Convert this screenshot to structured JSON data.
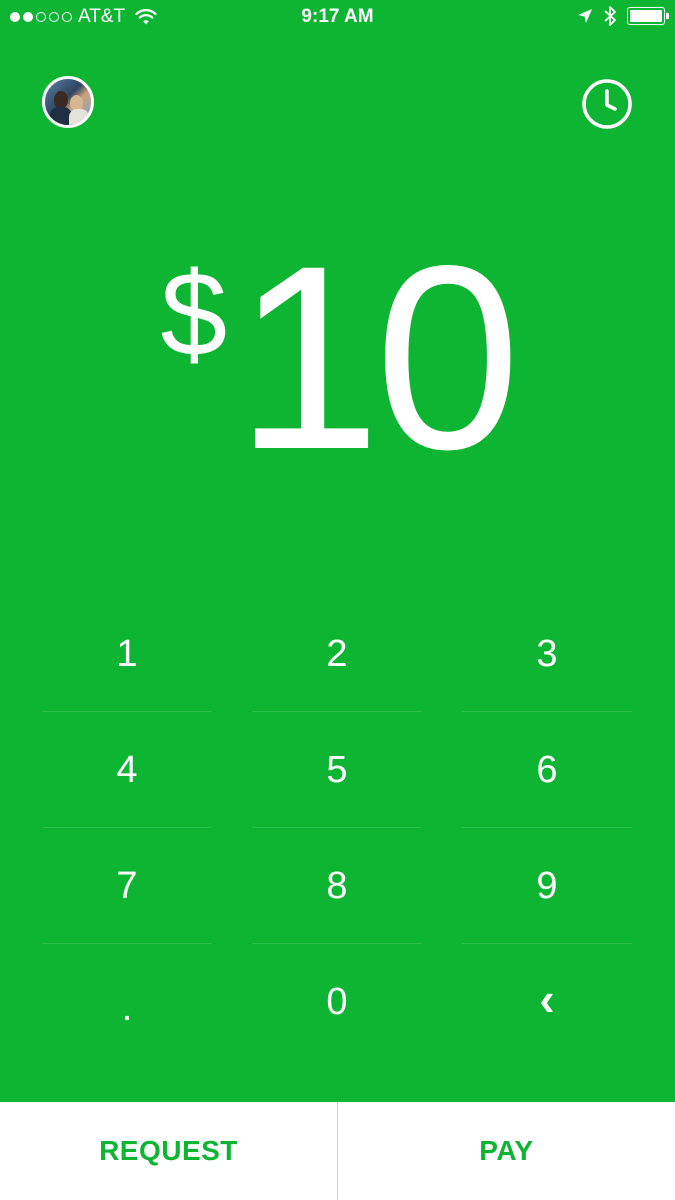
{
  "status_bar": {
    "carrier": "AT&T",
    "time": "9:17 AM",
    "signal_dots_filled": 2,
    "signal_dots_total": 5
  },
  "header": {
    "avatar_icon": "profile-avatar",
    "history_icon": "clock-icon"
  },
  "amount": {
    "currency": "$",
    "value": "10"
  },
  "keypad": {
    "keys": [
      "1",
      "2",
      "3",
      "4",
      "5",
      "6",
      "7",
      "8",
      "9",
      ".",
      "0",
      "‹"
    ]
  },
  "actions": {
    "request_label": "REQUEST",
    "pay_label": "PAY"
  },
  "colors": {
    "brand_green": "#0eb533",
    "background_white": "#ffffff"
  }
}
